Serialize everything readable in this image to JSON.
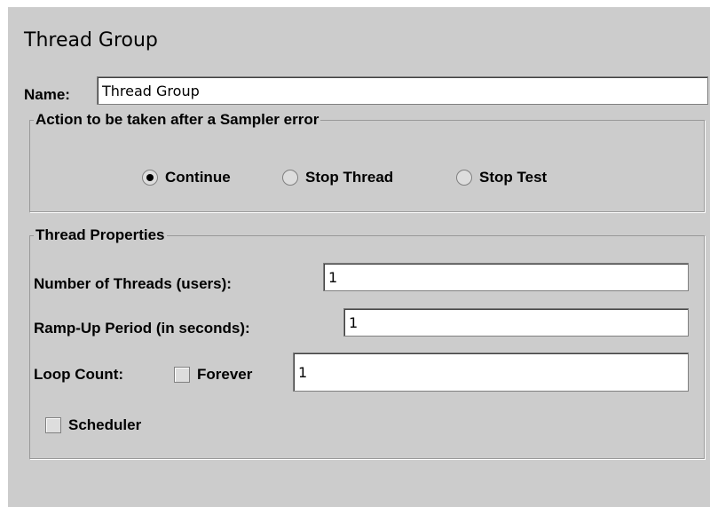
{
  "title": "Thread Group",
  "name": {
    "label": "Name:",
    "value": "Thread Group"
  },
  "action_group": {
    "title": "Action to be taken after a Sampler error",
    "options": [
      {
        "label": "Continue",
        "selected": true
      },
      {
        "label": "Stop Thread",
        "selected": false
      },
      {
        "label": "Stop Test",
        "selected": false
      }
    ]
  },
  "thread_properties": {
    "title": "Thread Properties",
    "num_threads": {
      "label": "Number of Threads (users):",
      "value": "1"
    },
    "ramp_up": {
      "label": "Ramp-Up Period (in seconds):",
      "value": "1"
    },
    "loop_count": {
      "label": "Loop Count:",
      "forever_label": "Forever",
      "forever_checked": false,
      "value": "1"
    },
    "scheduler": {
      "label": "Scheduler",
      "checked": false
    }
  },
  "colors": {
    "panel_bg": "#cccccc",
    "field_bg": "#ffffff",
    "border": "#999999"
  }
}
